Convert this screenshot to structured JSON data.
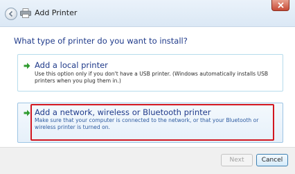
{
  "window": {
    "title": "Add Printer",
    "icons": {
      "back": "back-arrow-icon",
      "app": "printer-icon",
      "close": "close-icon"
    }
  },
  "wizard": {
    "heading": "What type of printer do you want to install?",
    "options": [
      {
        "title": "Add a local printer",
        "description": "Use this option only if you don't have a USB printer. (Windows automatically installs USB printers when you plug them in.)",
        "icon": "green-arrow-icon"
      },
      {
        "title": "Add a network, wireless or Bluetooth printer",
        "description": "Make sure that your computer is connected to the network, or that your Bluetooth or wireless printer is turned on.",
        "icon": "green-arrow-icon",
        "highlighted": true
      }
    ]
  },
  "footer": {
    "next_label": "Next",
    "cancel_label": "Cancel",
    "next_enabled": false
  },
  "colors": {
    "heading": "#1f3a8a",
    "highlight_border": "#d2161f",
    "arrow": "#2f9b2f"
  }
}
